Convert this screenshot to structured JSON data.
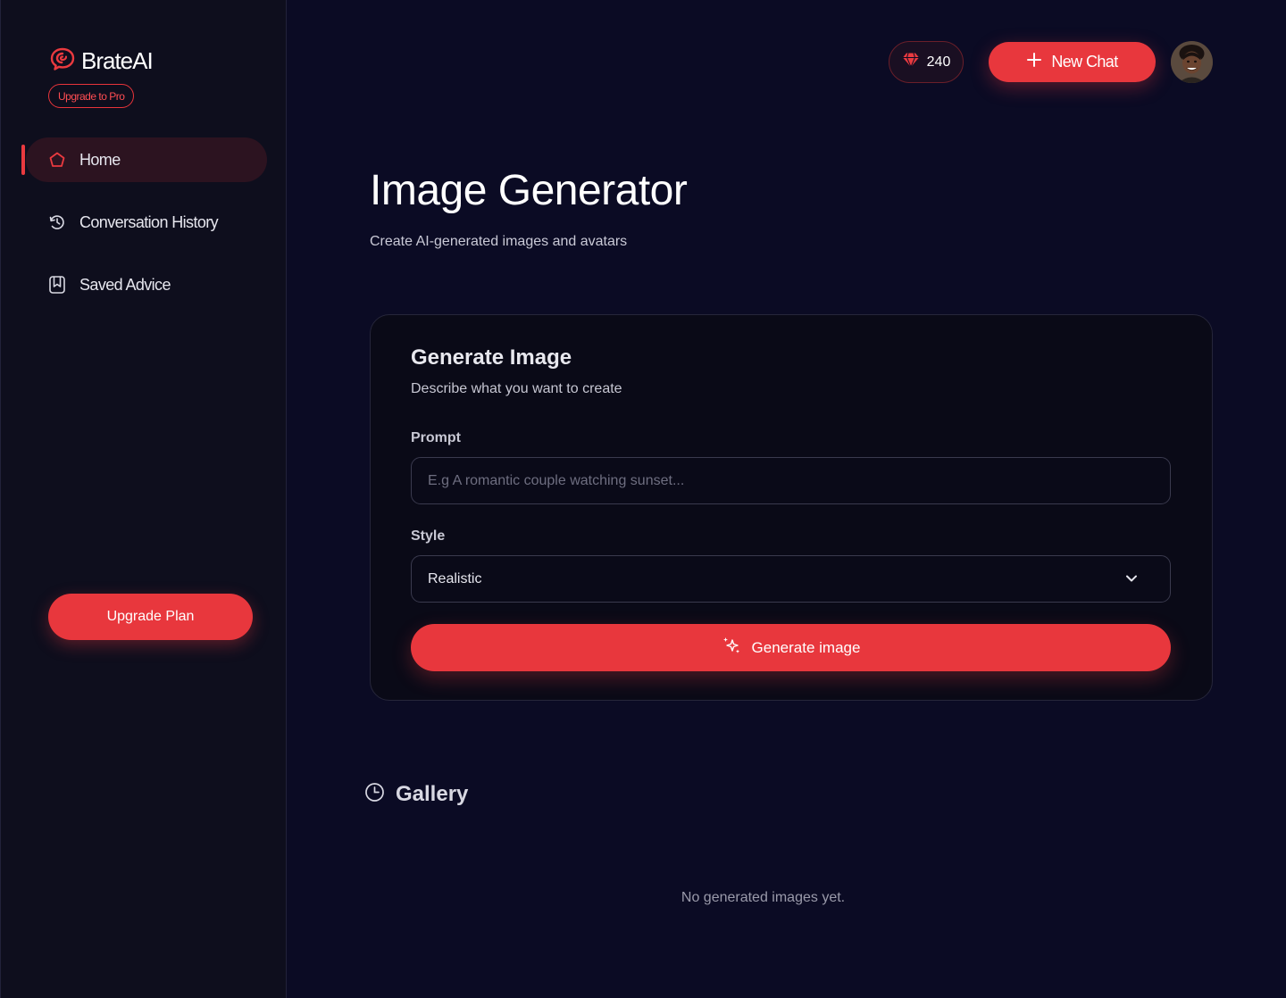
{
  "brand": {
    "name": "BrateAI",
    "upgrade_badge": "Upgrade to Pro"
  },
  "sidebar": {
    "items": [
      {
        "label": "Home",
        "icon": "home-icon",
        "active": true
      },
      {
        "label": "Conversation History",
        "icon": "history-icon",
        "active": false
      },
      {
        "label": "Saved Advice",
        "icon": "bookmark-icon",
        "active": false
      }
    ],
    "upgrade_button": "Upgrade Plan"
  },
  "header": {
    "gems_count": "240",
    "gems_icon": "gem-icon",
    "new_chat_label": "New Chat"
  },
  "main": {
    "title": "Image Generator",
    "subtitle": "Create AI-generated images and avatars",
    "card": {
      "title": "Generate Image",
      "subtitle": "Describe what you want to create",
      "prompt_label": "Prompt",
      "prompt_placeholder": "E.g A romantic couple watching sunset...",
      "prompt_value": "",
      "style_label": "Style",
      "style_value": "Realistic",
      "generate_label": "Generate image"
    },
    "gallery": {
      "title": "Gallery",
      "empty_message": "No generated images yet."
    }
  },
  "colors": {
    "accent": "#e8373d",
    "background": "#0b0b24",
    "sidebar": "#0e0e1d",
    "card": "#0a0a17"
  }
}
